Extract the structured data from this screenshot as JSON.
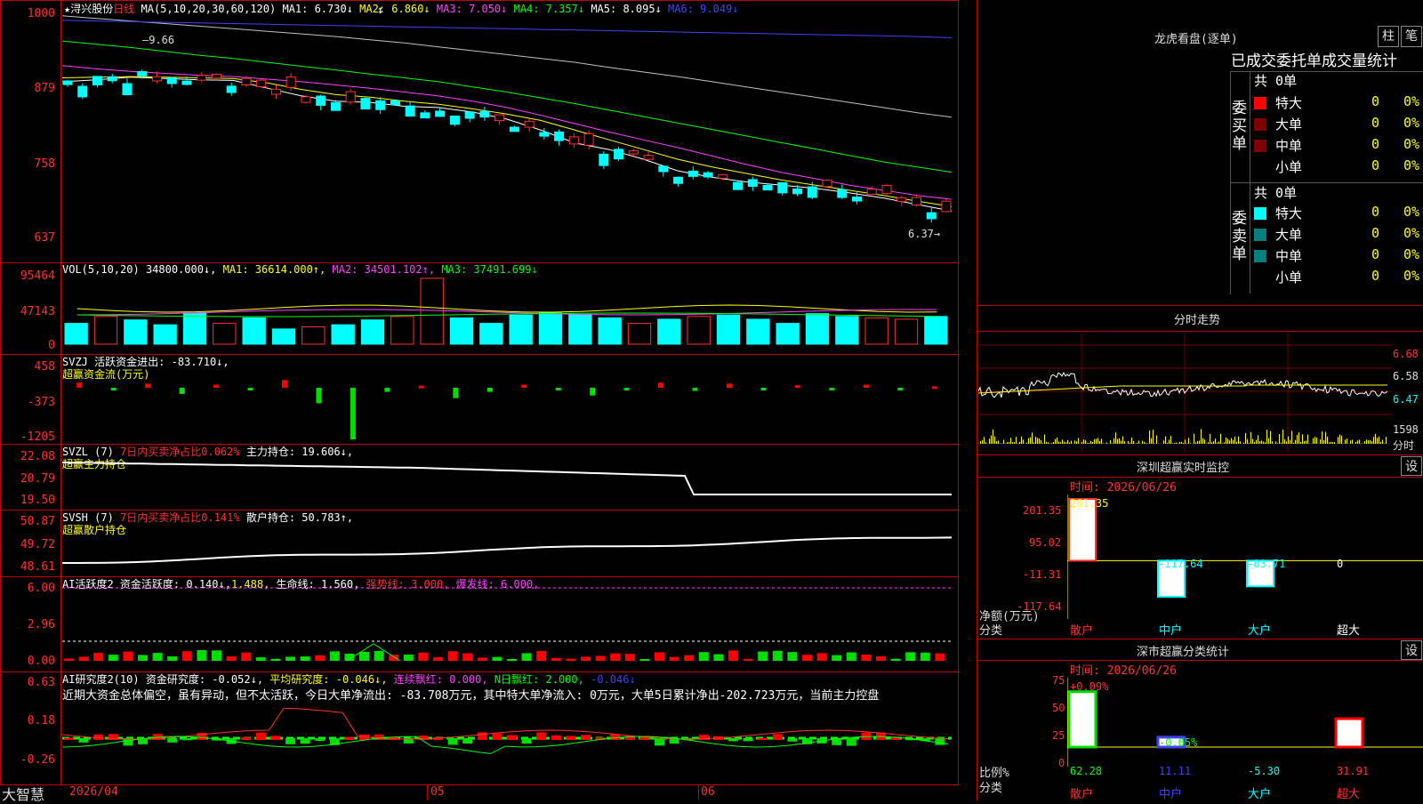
{
  "chart_data": [
    {
      "type": "line",
      "chart": "price-candlestick",
      "yticks": [
        "1000",
        "879",
        "758",
        "637"
      ],
      "ylim": [
        620,
        1000
      ],
      "annotations": [
        "9.66",
        "6.37"
      ],
      "series": [
        {
          "name": "MA1",
          "values": [
            890,
            893,
            897,
            895,
            893,
            892,
            880,
            868,
            860,
            858,
            852,
            850,
            843,
            832,
            815,
            795,
            785,
            770,
            752,
            742,
            735,
            730,
            725,
            718,
            710,
            700,
            690
          ]
        },
        {
          "name": "MA2",
          "values": [
            896,
            897,
            898,
            897,
            896,
            895,
            888,
            878,
            870,
            866,
            860,
            855,
            848,
            840,
            830,
            815,
            800,
            785,
            770,
            758,
            748,
            738,
            730,
            722,
            714,
            705,
            697
          ]
        },
        {
          "name": "MA3",
          "values": [
            915,
            910,
            906,
            903,
            900,
            898,
            894,
            890,
            885,
            880,
            874,
            868,
            860,
            850,
            838,
            825,
            812,
            800,
            788,
            775,
            762,
            750,
            740,
            730,
            722,
            714,
            708
          ]
        },
        {
          "name": "MA4",
          "values": [
            953,
            948,
            943,
            937,
            931,
            926,
            920,
            914,
            908,
            902,
            896,
            890,
            882,
            874,
            865,
            856,
            846,
            836,
            826,
            816,
            806,
            796,
            786,
            776,
            766,
            758,
            750
          ]
        },
        {
          "name": "MA5",
          "values": [
            992,
            988,
            984,
            980,
            976,
            972,
            968,
            964,
            960,
            955,
            950,
            944,
            938,
            932,
            926,
            920,
            912,
            905,
            898,
            890,
            882,
            874,
            866,
            858,
            850,
            842,
            835
          ]
        },
        {
          "name": "MA6",
          "values": [
            985,
            984,
            983,
            982,
            981,
            980,
            979,
            978,
            977,
            976,
            975,
            974,
            973,
            972,
            971,
            970,
            969,
            968,
            967,
            966,
            965,
            964,
            963,
            962,
            961,
            960,
            958
          ]
        }
      ]
    },
    {
      "type": "bar",
      "chart": "volume",
      "yticks": [
        "95464",
        "47143",
        "0"
      ],
      "values": [
        30,
        40,
        35,
        28,
        45,
        30,
        38,
        22,
        25,
        28,
        35,
        40,
        95,
        38,
        30,
        42,
        45,
        43,
        38,
        30,
        36,
        40,
        42,
        36,
        30,
        44,
        40,
        38,
        36,
        40
      ]
    },
    {
      "type": "bar",
      "chart": "fund-flow",
      "yticks": [
        "458",
        "-373",
        "-1205"
      ],
      "values": [
        100,
        -50,
        80,
        -120,
        60,
        -40,
        150,
        -300,
        -1000,
        -80,
        40,
        -200,
        -80,
        60,
        -50,
        -150,
        -40,
        100,
        -60,
        80,
        -30,
        50,
        -40,
        60,
        -50,
        30
      ]
    },
    {
      "type": "line",
      "chart": "main-holding",
      "yticks": [
        "22.08",
        "20.79",
        "19.50"
      ]
    },
    {
      "type": "line",
      "chart": "retail-holding",
      "yticks": [
        "50.87",
        "49.72",
        "48.61"
      ]
    },
    {
      "type": "bar",
      "chart": "activity",
      "yticks": [
        "6.00",
        "2.96",
        "0.00"
      ]
    },
    {
      "type": "bar",
      "chart": "research",
      "yticks": [
        "0.63",
        "0.18",
        "-0.26"
      ]
    },
    {
      "type": "bar",
      "chart": "realtime-monitor",
      "yticks": [
        "201.35",
        "95.02",
        "-11.31",
        "-117.64"
      ],
      "categories": [
        "散户",
        "中户",
        "大户",
        "超大"
      ],
      "values": [
        201.35,
        -117.64,
        -83.71,
        0
      ],
      "ylim": [
        -117.64,
        201.35
      ]
    },
    {
      "type": "bar",
      "chart": "category-stats",
      "yticks": [
        "75",
        "50",
        "25",
        "0"
      ],
      "categories": [
        "散户",
        "中户",
        "大户",
        "超大"
      ],
      "values": [
        62.28,
        11.11,
        -5.3,
        31.91
      ],
      "ylim": [
        0,
        75
      ]
    }
  ],
  "header": {
    "star": "★",
    "stock_name": "浔兴股份",
    "period": "日线",
    "ma_label": "MA(5,10,20,30,60,120)",
    "ma1": "MA1: 6.730↓",
    "ma2": "MA2: 6.860↓",
    "ma3": "MA3: 7.050↓",
    "ma4": "MA4: 7.357↓",
    "ma5": "MA5: 8.095↓",
    "ma6": "MA6: 9.049↓",
    "marker": "↕"
  },
  "vol_header": {
    "label": "VOL(5,10,20)",
    "val": "34800.000↓,",
    "ma1": "MA1: 36614.000↑,",
    "ma2": "MA2: 34501.102↑,",
    "ma3": "MA3: 37491.699↓"
  },
  "svzj": {
    "label": "SVZJ",
    "text": "活跃资金进出: -83.710↓,",
    "sub": "超赢资金流(万元)"
  },
  "svzl": {
    "label": "SVZL (7)",
    "text1": "7日内买卖净占比0.062%",
    "text2": "主力持仓: 19.606↓,",
    "sub": "超赢主力持仓"
  },
  "svsh": {
    "label": "SVSH (7)",
    "text1": "7日内买卖净占比0.141%",
    "text2": "散户持仓: 50.783↑,",
    "sub": "超赢散户持仓"
  },
  "ai1": {
    "label": "AI活跃度2",
    "t1": "资金活跃度: 0.140↓,",
    "t2": "1.488,",
    "t3": "生命线: 1.560,",
    "t4": "强势线: 3.000,",
    "t5": "爆发线: 6.000,"
  },
  "ai2": {
    "label": "AI研究度2(10)",
    "t1": "资金研究度: -0.052↓,",
    "t2": "平均研究度: -0.046↓,",
    "t3": "连续飘红: 0.000,",
    "t4": "N日飘红: 2.000,",
    "t5": "-0.046↓",
    "desc": "近期大资金总体偏空，虽有异动，但不太活跃，今日大单净流出: -83.708万元，其中特大单净流入: 0万元，大单5日累计净出-202.723万元，当前主力控盘"
  },
  "xaxis": {
    "brand": "大智慧",
    "date": "2026/04",
    "m05": "05",
    "m06": "06"
  },
  "longhu": {
    "title": "龙虎看盘(逐单)",
    "btn1": "柱",
    "btn2": "笔",
    "subtitle": "已成交委托单成交量统计",
    "buy_label": "委买单",
    "sell_label": "委卖单",
    "buy_total": "共 0单",
    "sell_total": "共 0单",
    "rows": [
      {
        "name": "特大",
        "count": "0",
        "pct": "0%"
      },
      {
        "name": "大单",
        "count": "0",
        "pct": "0%"
      },
      {
        "name": "中单",
        "count": "0",
        "pct": "0%"
      },
      {
        "name": "小单",
        "count": "0",
        "pct": "0%"
      }
    ],
    "colors": {
      "buy_big": "#ff0000",
      "buy_large": "#800000",
      "buy_mid": "#800000",
      "sell_big": "#00ffff",
      "sell_large": "#008080",
      "sell_mid": "#008080"
    }
  },
  "intraday": {
    "title": "分时走势",
    "y1": "6.68",
    "y2": "6.58",
    "y3": "6.47",
    "vol": "1598",
    "vol_lbl": "分时"
  },
  "monitor": {
    "title": "深圳超赢实时监控",
    "btn": "设",
    "time": "时间: 2026/06/26",
    "vals": [
      "201.35",
      "-117.64",
      "-83.71",
      "0"
    ],
    "axis_title": "净额(万元)",
    "axis_sub": "分类",
    "cats": [
      "散户",
      "中户",
      "大户",
      "超大"
    ]
  },
  "stats": {
    "title": "深市超赢分类统计",
    "btn": "设",
    "time": "时间: 2026/06/26",
    "top1": "+0.09%",
    "top2": "-0.05%",
    "bot": [
      "62.28",
      "11.11",
      "-5.30",
      "31.91"
    ],
    "axis_title": "比例%",
    "axis_sub": "分类",
    "cats": [
      "散户",
      "中户",
      "大户",
      "超大"
    ]
  }
}
